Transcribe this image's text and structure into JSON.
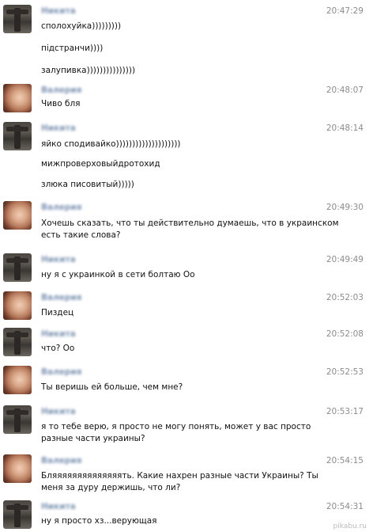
{
  "messages": [
    {
      "sender": "Никита",
      "avatar": "dark",
      "time": "20:47:29",
      "lines": [
        "сполохуйка)))))))))",
        "підстранчи))))",
        "залупивка)))))))))))))))"
      ]
    },
    {
      "sender": "Валерия",
      "avatar": "girl",
      "time": "20:48:07",
      "lines": [
        "Чиво бля"
      ]
    },
    {
      "sender": "Никита",
      "avatar": "dark",
      "time": "20:48:14",
      "lines": [
        "яйко сподивайко))))))))))))))))))))",
        "мижпроверховыйдротохид",
        "злюка писовитый)))))"
      ]
    },
    {
      "sender": "Валерия",
      "avatar": "girl",
      "time": "20:49:30",
      "lines": [
        "Хочешь сказать, что ты действительно думаешь, что в украинском",
        "есть такие слова?"
      ]
    },
    {
      "sender": "Никита",
      "avatar": "dark",
      "time": "20:49:49",
      "lines": [
        "ну я с украинкой в сети болтаю Оо"
      ]
    },
    {
      "sender": "Валерия",
      "avatar": "girl",
      "time": "20:52:03",
      "lines": [
        "Пиздец"
      ]
    },
    {
      "sender": "Никита",
      "avatar": "dark",
      "time": "20:52:08",
      "lines": [
        "что? Оо"
      ]
    },
    {
      "sender": "Валерия",
      "avatar": "girl",
      "time": "20:52:53",
      "lines": [
        "Ты веришь ей больше, чем мне?"
      ]
    },
    {
      "sender": "Никита",
      "avatar": "dark",
      "time": "20:53:17",
      "lines": [
        "я то тебе верю, я просто не могу понять, может у вас просто",
        "разные части украины?"
      ]
    },
    {
      "sender": "Валерия",
      "avatar": "girl",
      "time": "20:54:15",
      "lines": [
        "Бляяяяяяяяяяяяяять. Какие нахрен разные части Украины? Ты",
        "меня за дуру держишь, что ли?"
      ]
    },
    {
      "sender": "Никита",
      "avatar": "dark",
      "time": "20:54:31",
      "lines": [
        "ну я просто хз...верующая"
      ]
    }
  ],
  "watermark": "pikabu.ru"
}
